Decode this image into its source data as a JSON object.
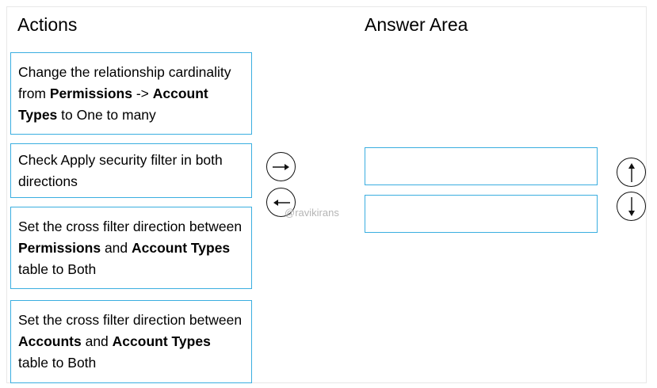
{
  "headings": {
    "actions": "Actions",
    "answer_area": "Answer Area"
  },
  "actions": [
    {
      "segments": [
        {
          "text": "Change the relationship cardinality from ",
          "bold": false
        },
        {
          "text": "Permissions",
          "bold": true
        },
        {
          "text": " -> ",
          "bold": false
        },
        {
          "text": "Account Types",
          "bold": true
        },
        {
          "text": " to One to many",
          "bold": false
        }
      ]
    },
    {
      "segments": [
        {
          "text": "Check Apply security filter in both directions",
          "bold": false
        }
      ]
    },
    {
      "segments": [
        {
          "text": "Set the cross filter direction between ",
          "bold": false
        },
        {
          "text": "Permissions",
          "bold": true
        },
        {
          "text": " and ",
          "bold": false
        },
        {
          "text": "Account Types",
          "bold": true
        },
        {
          "text": " table to Both",
          "bold": false
        }
      ]
    },
    {
      "segments": [
        {
          "text": "Set the cross filter direction between ",
          "bold": false
        },
        {
          "text": "Accounts",
          "bold": true
        },
        {
          "text": " and ",
          "bold": false
        },
        {
          "text": "Account Types",
          "bold": true
        },
        {
          "text": " table to Both",
          "bold": false
        }
      ]
    }
  ],
  "answer_slots": [
    "",
    ""
  ],
  "controls": {
    "move_right_icon": "arrow-right-icon",
    "move_left_icon": "arrow-left-icon",
    "move_up_icon": "arrow-up-icon",
    "move_down_icon": "arrow-down-icon"
  },
  "watermark": "@ravikirans",
  "colors": {
    "card_border": "#3aaee0",
    "control_border": "#111111",
    "watermark": "#b5b5b5"
  }
}
